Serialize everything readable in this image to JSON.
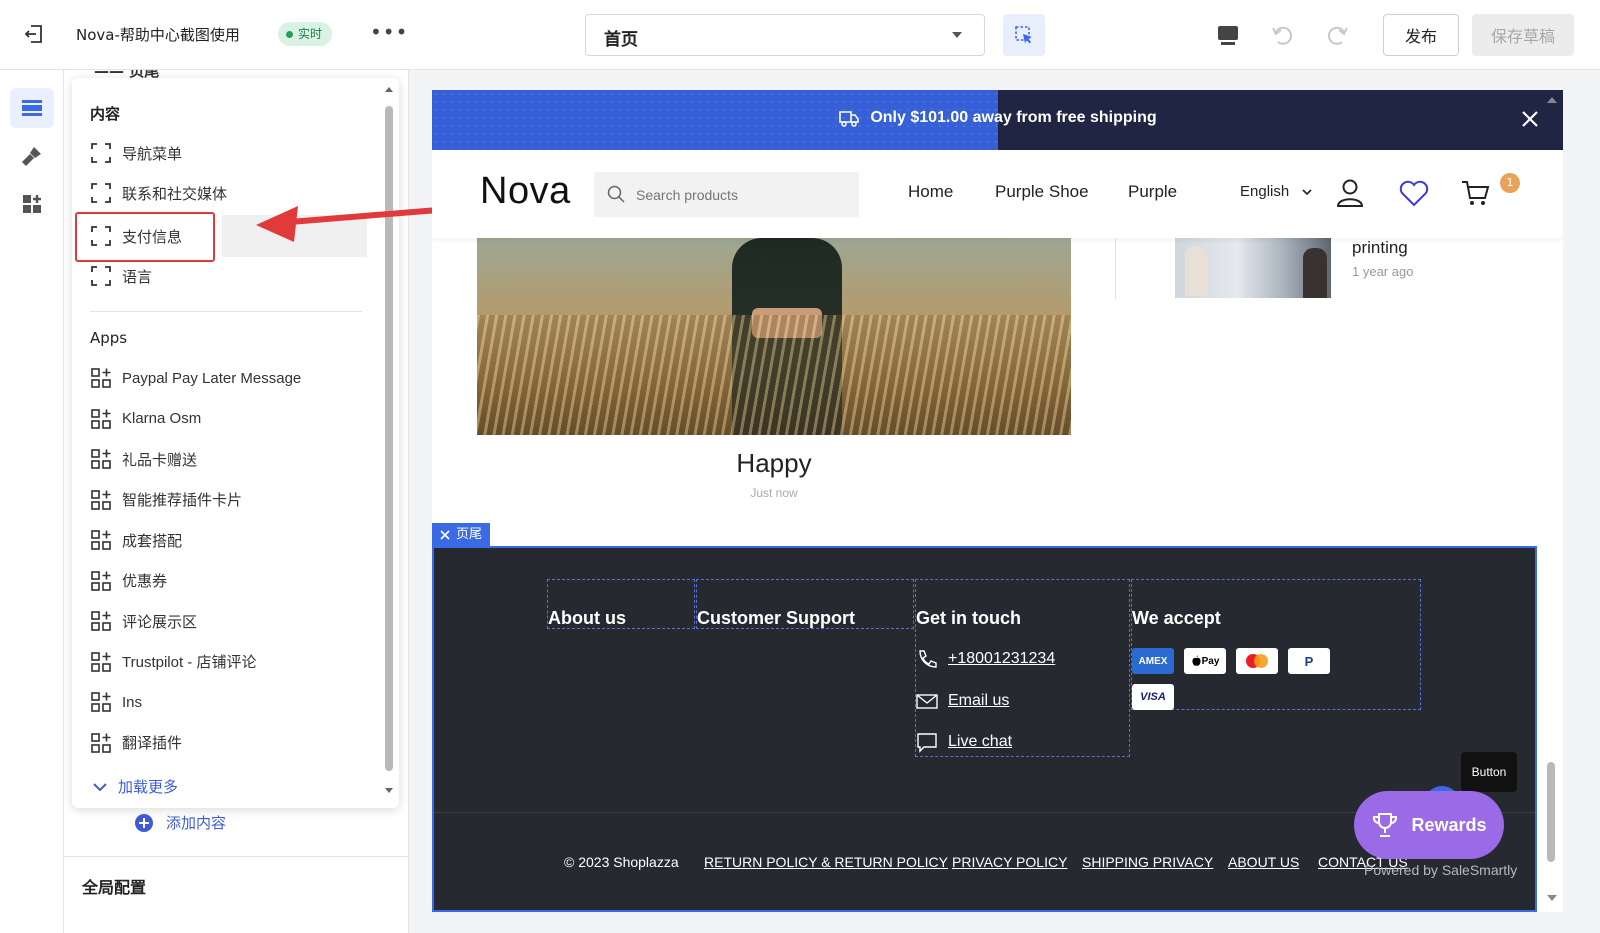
{
  "topbar": {
    "title": "Nova-帮助中心截图使用",
    "status_badge": "实时",
    "more": "•••",
    "page_select": "首页",
    "publish": "发布",
    "save_draft": "保存草稿"
  },
  "panel": {
    "peek_text": "—— 页尾",
    "sections": {
      "content_header": "内容",
      "apps_header": "Apps"
    },
    "content_items": [
      {
        "label": "导航菜单"
      },
      {
        "label": "联系和社交媒体"
      },
      {
        "label": "支付信息"
      },
      {
        "label": "语言"
      }
    ],
    "app_items": [
      {
        "label": "Paypal Pay Later Message"
      },
      {
        "label": "Klarna Osm"
      },
      {
        "label": "礼品卡赠送"
      },
      {
        "label": "智能推荐插件卡片"
      },
      {
        "label": "成套搭配"
      },
      {
        "label": "优惠券"
      },
      {
        "label": "评论展示区"
      },
      {
        "label": "Trustpilot - 店铺评论"
      },
      {
        "label": "Ins"
      },
      {
        "label": "翻译插件"
      }
    ],
    "load_more": "加载更多",
    "add_content": "添加内容",
    "global_config": "全局配置"
  },
  "preview": {
    "announcement": {
      "text": "Only $101.00 away from free shipping",
      "progress_fraction": 0.5
    },
    "header": {
      "logo": "Nova",
      "search_placeholder": "Search products",
      "nav": [
        "Home",
        "Purple Shoe",
        "Purple"
      ],
      "language": "English",
      "cart_count": "1"
    },
    "blog": {
      "main_title": "Happy",
      "main_time": "Just now",
      "side_title": "printing",
      "side_time": "1 year ago"
    },
    "footer": {
      "tag": "页尾",
      "columns": {
        "about": "About us",
        "support": "Customer Support",
        "contact": "Get in touch",
        "accept": "We accept"
      },
      "contact_links": {
        "phone": "+18001231234",
        "email": "Email us",
        "chat": "Live chat"
      },
      "payments": [
        "AMEX",
        "Pay",
        "",
        "P",
        "VISA"
      ],
      "copyright": "© 2023 Shoplazza",
      "policies": [
        "RETURN POLICY & RETURN POLICY",
        "PRIVACY POLICY",
        "SHIPPING PRIVACY",
        "ABOUT US",
        "CONTACT US"
      ],
      "powered": "Powered by SaleSmartly",
      "button_tip": "Button",
      "rewards": "Rewards"
    }
  },
  "colors": {
    "accent": "#3a6ae6",
    "announce_bg": "#1f2542",
    "footer_bg": "#262930",
    "highlight_red": "#e03a3a",
    "rewards": "#9b6ae6"
  }
}
